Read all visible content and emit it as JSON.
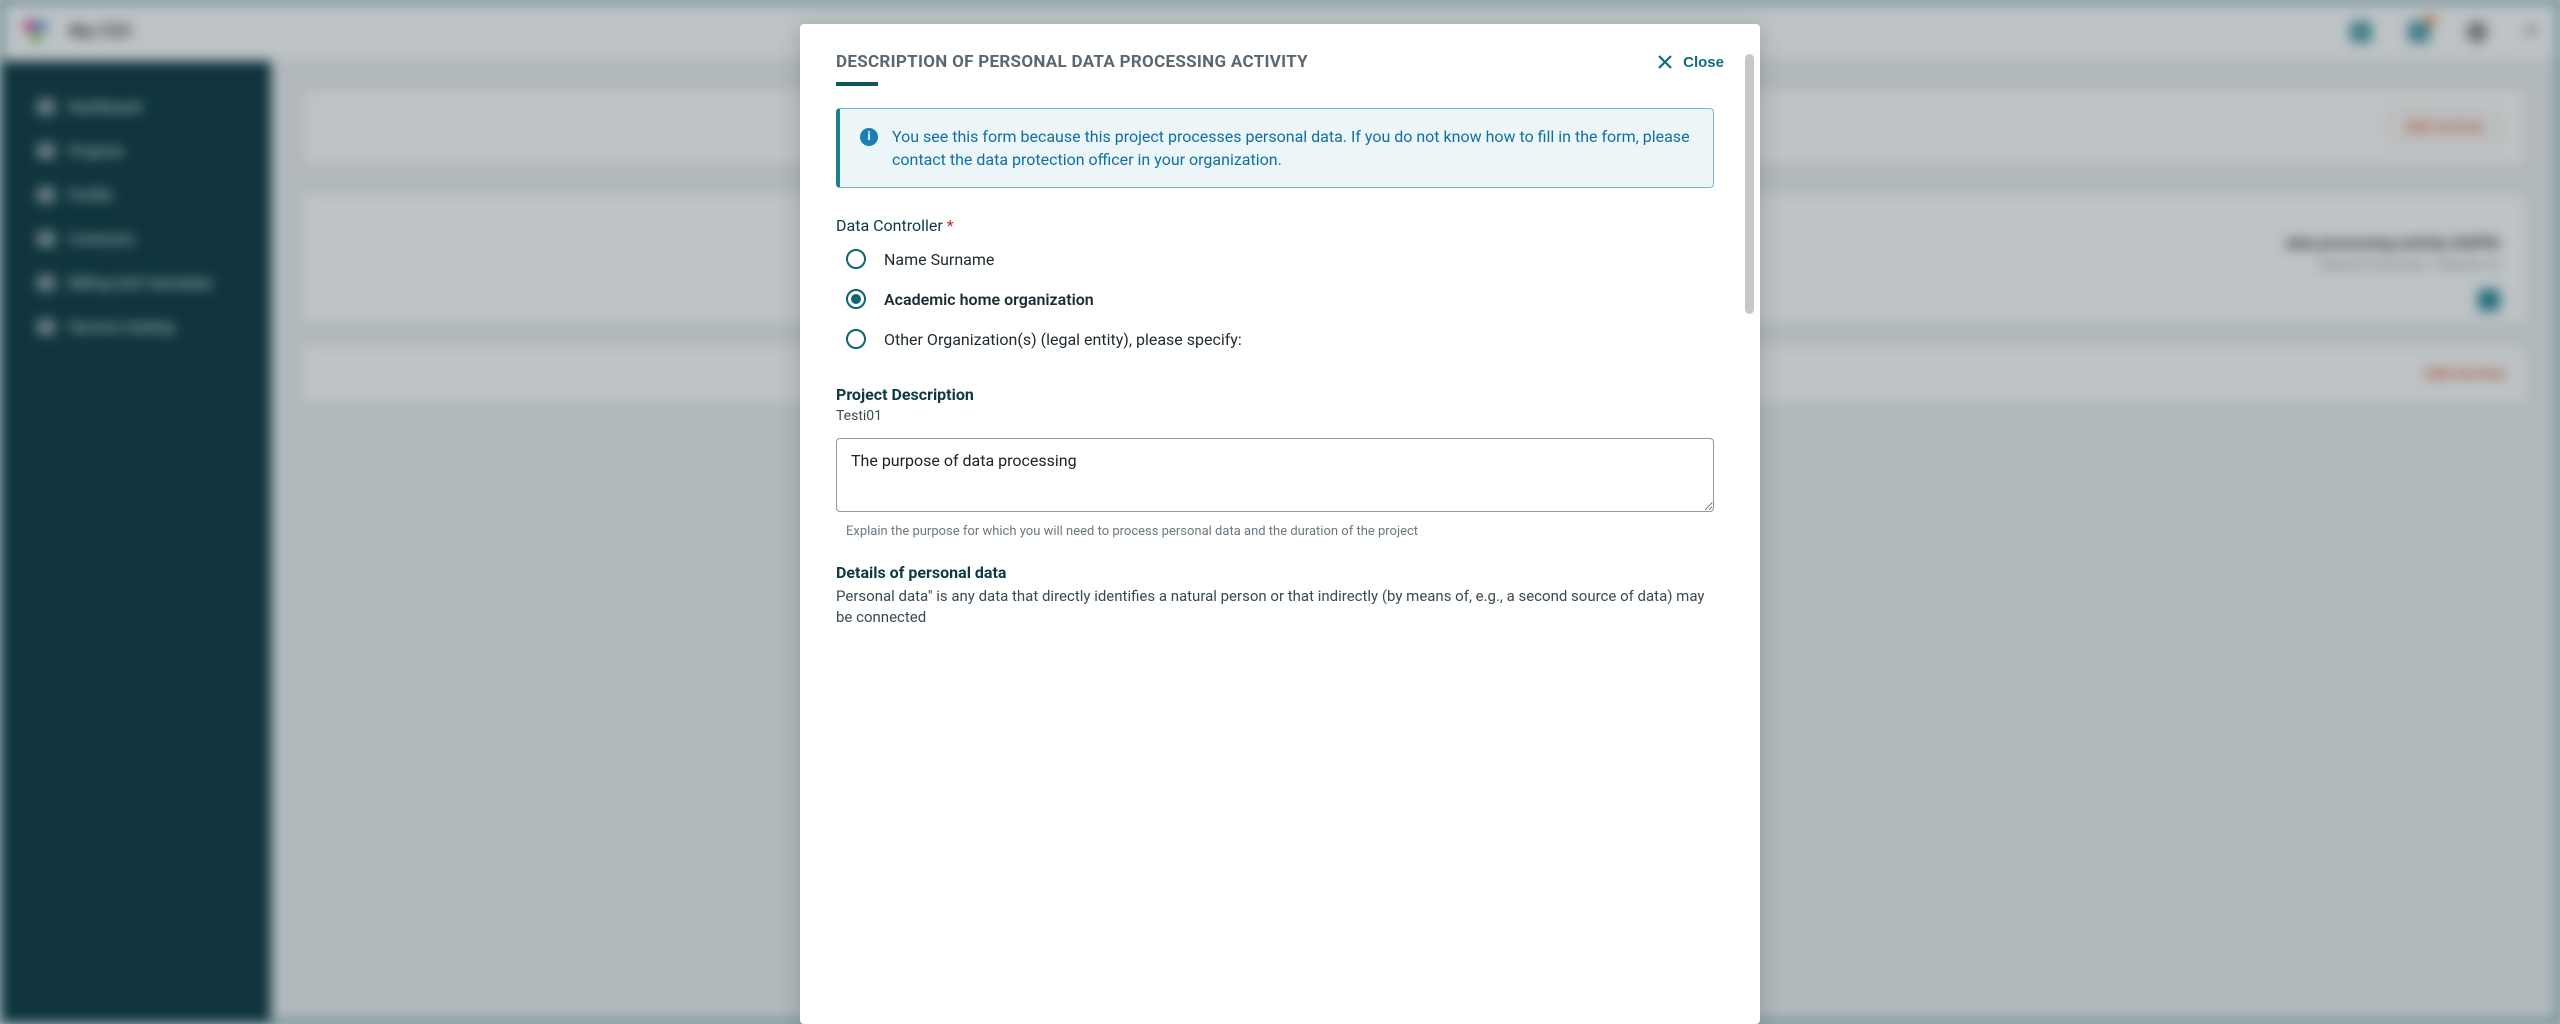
{
  "app": {
    "title": "My CSC"
  },
  "sidebar": {
    "items": [
      {
        "label": "Dashboard"
      },
      {
        "label": "Projects"
      },
      {
        "label": "Profile"
      },
      {
        "label": "Contracts"
      },
      {
        "label": "Billing Unit Calculator"
      },
      {
        "label": "Service Catalog"
      }
    ]
  },
  "bg": {
    "add_services": "Add services",
    "panel_heading": "data processing activity (GDPR)",
    "panel_sub": "Helsinki University / Helsinki Oy",
    "add_services2": "Add services"
  },
  "modal": {
    "title": "DESCRIPTION OF PERSONAL DATA PROCESSING ACTIVITY",
    "close": "Close",
    "info": "You see this form because this project processes personal data. If you do not know how to fill in the form, please contact the data protection officer in your organization.",
    "data_controller_label": "Data Controller",
    "radios": {
      "opt0": "Name Surname",
      "opt1": "Academic home organization",
      "opt2": "Other Organization(s) (legal entity), please specify:"
    },
    "proj_desc_h": "Project Description",
    "proj_desc_sub": "Testi01",
    "purpose_value": "The purpose of data processing",
    "purpose_help": "Explain the purpose for which you will need to process personal data and the duration of the project",
    "details_h": "Details of personal data",
    "details_p": "Personal data\" is any data that directly identifies a natural person or that indirectly (by means of, e.g., a second source of data) may be connected"
  }
}
